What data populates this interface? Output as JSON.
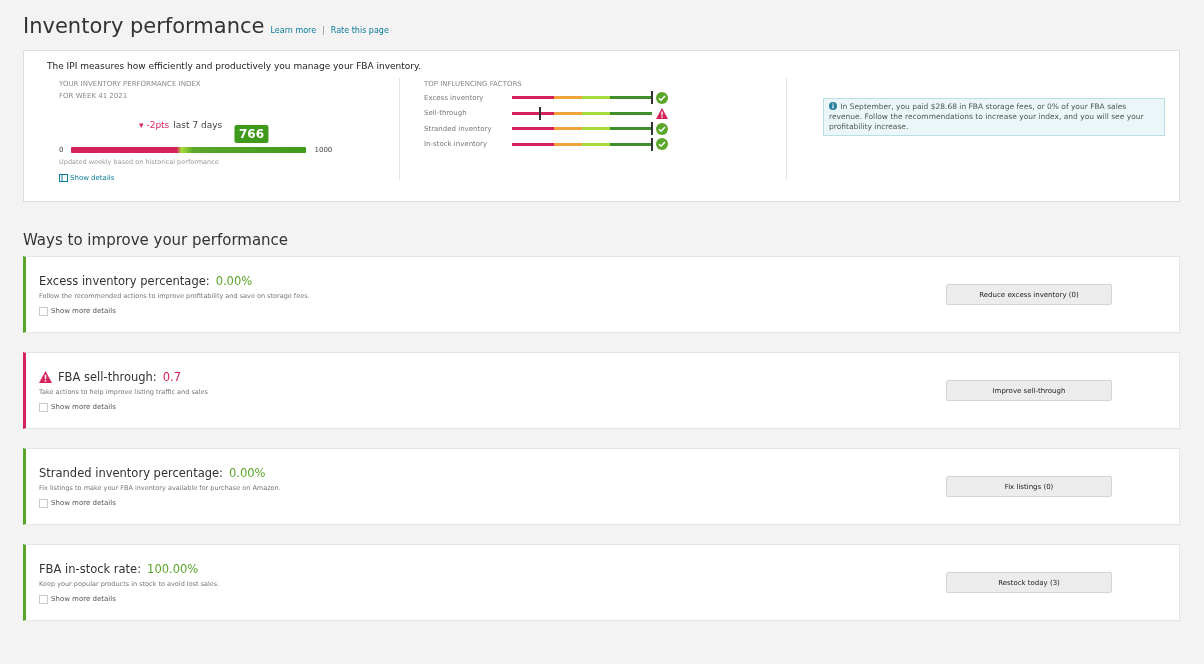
{
  "header": {
    "title": "Inventory performance",
    "links": [
      "Learn more",
      "Rate this page"
    ],
    "separator": "|"
  },
  "summary": {
    "intro": "The IPI measures how efficiently and productively you manage your FBA inventory.",
    "ipi": {
      "label": "YOUR INVENTORY PERFORMANCE INDEX",
      "week": "FOR WEEK 41 2021",
      "trend_icon": "▾",
      "trend": "-2pts",
      "period": "last 7 days",
      "score": "766",
      "level": 0.766,
      "min": "0",
      "max": "1000",
      "note": "Updated weekly based on historical performance",
      "details_link": "Show details"
    },
    "factors_title": "TOP INFLUENCING FACTORS",
    "factors": [
      {
        "name": "Excess inventory",
        "level": 1.0,
        "kind": "ok"
      },
      {
        "name": "Sell-through",
        "level": 0.2,
        "kind": "warning"
      },
      {
        "name": "Stranded inventory",
        "level": 1.0,
        "kind": "ok"
      },
      {
        "name": "In-stock inventory",
        "level": 1.0,
        "kind": "ok"
      }
    ],
    "info": "In September, you paid $28.68 in FBA storage fees, or 0% of your FBA sales revenue. Follow the recommendations to increase your index, and you will see your profitability increase."
  },
  "improve": {
    "title": "Ways to improve your performance",
    "cards": [
      {
        "title": "Excess inventory percentage:",
        "value": "0.00%",
        "kind": "ok",
        "description": "Follow the recommended actions to improve profitability and save on storage fees.",
        "checkbox": "Show more details",
        "checked": false,
        "button": "Reduce excess inventory (0)"
      },
      {
        "title": "FBA sell-through:",
        "value": "0.7",
        "kind": "warning",
        "description": "Take actions to help improve listing traffic and sales",
        "checkbox": "Show more details",
        "checked": false,
        "button": "Improve sell-through"
      },
      {
        "title": "Stranded inventory percentage:",
        "value": "0.00%",
        "kind": "ok",
        "description": "Fix listings to make your FBA inventory available for purchase on Amazon.",
        "checkbox": "Show more details",
        "checked": false,
        "button": "Fix listings (0)"
      },
      {
        "title": "FBA in-stock rate:",
        "value": "100.00%",
        "kind": "ok",
        "description": "Keep your popular products in stock to avoid lost sales.",
        "checkbox": "Show more details",
        "checked": false,
        "button": "Restock today (3)"
      }
    ]
  }
}
